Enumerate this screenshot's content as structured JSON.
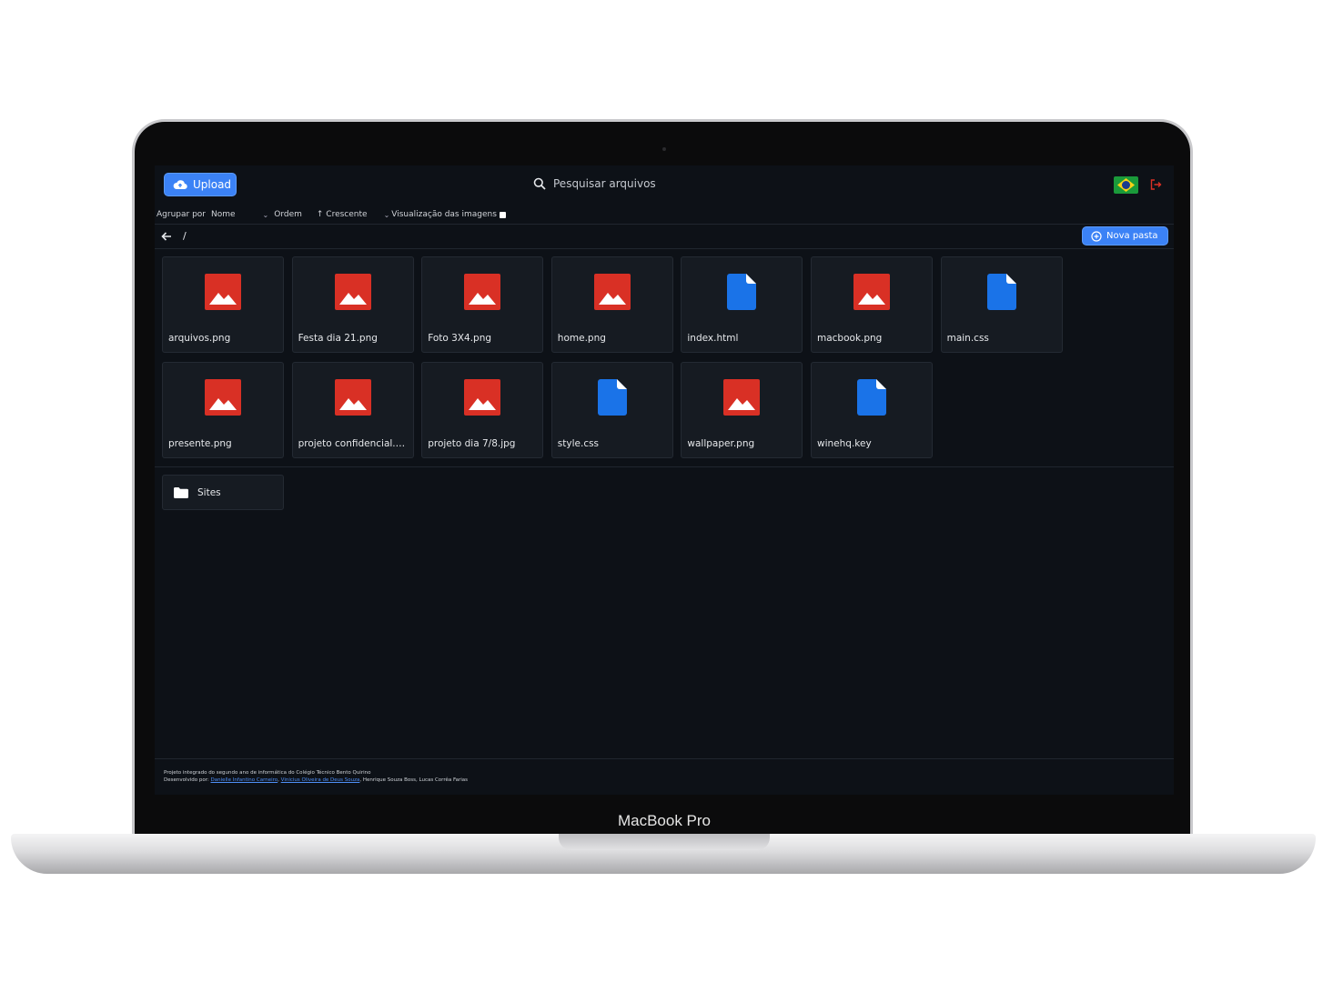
{
  "device": {
    "model_label": "MacBook Pro"
  },
  "topbar": {
    "upload_label": "Upload",
    "search_placeholder": "Pesquisar arquivos",
    "language_flag": "brazil-flag-icon",
    "logout_icon": "logout-icon"
  },
  "filters": {
    "group_label": "Agrupar por",
    "group_value": "Nome",
    "order_label": "Ordem",
    "order_value": "↑ Crescente",
    "preview_label": "Visualização das imagens"
  },
  "path": {
    "back_icon": "arrow-left-icon",
    "current": "/",
    "new_folder_label": "Nova pasta"
  },
  "files": [
    {
      "name": "arquivos.png",
      "type": "image"
    },
    {
      "name": "Festa dia 21.png",
      "type": "image"
    },
    {
      "name": "Foto 3X4.png",
      "type": "image"
    },
    {
      "name": "home.png",
      "type": "image"
    },
    {
      "name": "index.html",
      "type": "doc"
    },
    {
      "name": "macbook.png",
      "type": "image"
    },
    {
      "name": "main.css",
      "type": "doc"
    },
    {
      "name": "presente.png",
      "type": "image"
    },
    {
      "name": "projeto confidencial.png",
      "type": "image"
    },
    {
      "name": "projeto dia 7/8.jpg",
      "type": "image"
    },
    {
      "name": "style.css",
      "type": "doc"
    },
    {
      "name": "wallpaper.png",
      "type": "image"
    },
    {
      "name": "winehq.key",
      "type": "doc"
    }
  ],
  "folders": [
    {
      "name": "Sites"
    }
  ],
  "footer": {
    "line1": "Projeto integrado do segundo ano de informática do Colégio Técnico Bento Quirino",
    "line2_prefix": "Desenvolvido por:",
    "author1": "Danielle Infantino Carneiro",
    "author2": "Vinicius Oliveira de Deus Souza",
    "line2_suffix": ", Henrique Souza Boss, Lucas Corrêa Farias"
  },
  "colors": {
    "accent": "#3b82f6",
    "image_icon": "#d93025",
    "doc_icon": "#1a73e8",
    "background": "#0d1117",
    "card": "#161b22"
  }
}
